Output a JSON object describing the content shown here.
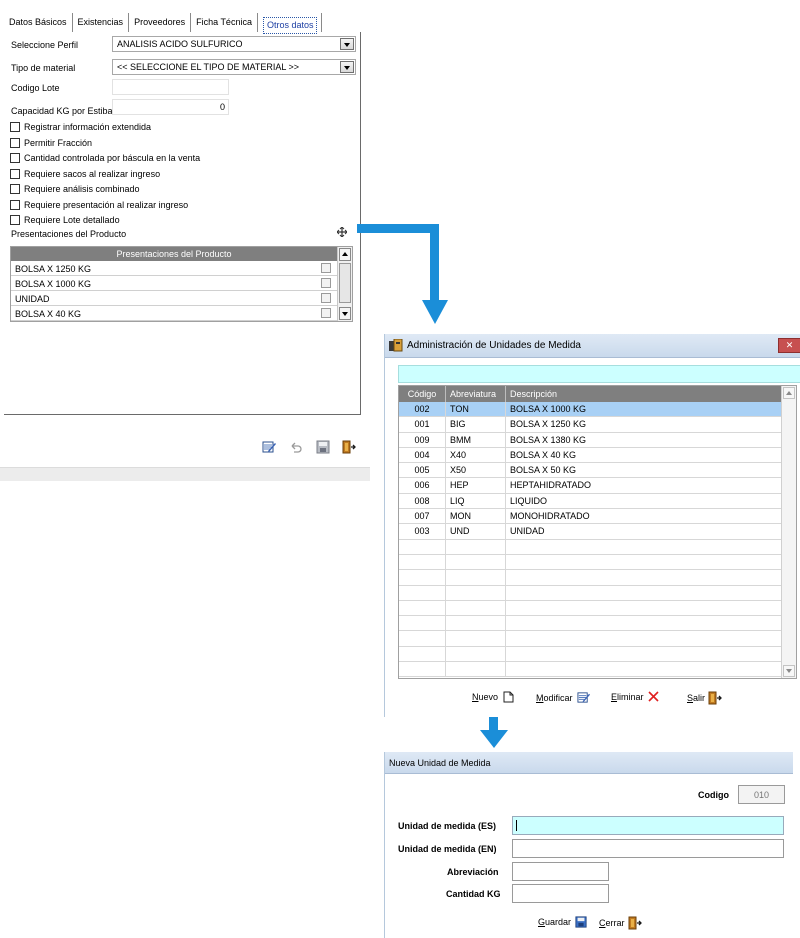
{
  "product_form": {
    "tabs": [
      "Datos Básicos",
      "Existencias",
      "Proveedores",
      "Ficha Técnica",
      "Otros datos"
    ],
    "active_tab": "Otros datos",
    "fields": {
      "perfil_label": "Seleccione Perfil",
      "perfil_value": "ANALISIS ACIDO SULFURICO",
      "tipo_label": "Tipo de material",
      "tipo_value": "<< SELECCIONE EL TIPO DE MATERIAL >>",
      "lote_label": "Codigo Lote",
      "lote_value": "",
      "capacidad_label": "Capacidad KG por Estiba",
      "capacidad_value": "0"
    },
    "checkboxes": [
      "Registrar información extendida",
      "Permitir Fracción",
      "Cantidad controlada por báscula en la venta",
      "Requiere sacos al realizar ingreso",
      "Requiere análisis combinado",
      "Requiere presentación al realizar ingreso",
      "Requiere Lote detallado"
    ],
    "presentaciones_label": "Presentaciones del Producto",
    "presentaciones_header": "Presentaciones del Producto",
    "presentaciones_rows": [
      "BOLSA X 1250 KG",
      "BOLSA X 1000 KG",
      "UNIDAD",
      "BOLSA X 40 KG"
    ]
  },
  "units_window": {
    "title": "Administración de Unidades de Medida",
    "columns": [
      "Código",
      "Abreviatura",
      "Descripción"
    ],
    "rows": [
      {
        "codigo": "002",
        "abrev": "TON",
        "desc": "BOLSA X 1000 KG",
        "selected": true
      },
      {
        "codigo": "001",
        "abrev": "BIG",
        "desc": "BOLSA X 1250 KG"
      },
      {
        "codigo": "009",
        "abrev": "BMM",
        "desc": "BOLSA X 1380 KG"
      },
      {
        "codigo": "004",
        "abrev": "X40",
        "desc": "BOLSA X 40 KG"
      },
      {
        "codigo": "005",
        "abrev": "X50",
        "desc": "BOLSA X 50 KG"
      },
      {
        "codigo": "006",
        "abrev": "HEP",
        "desc": "HEPTAHIDRATADO"
      },
      {
        "codigo": "008",
        "abrev": "LIQ",
        "desc": "LIQUIDO"
      },
      {
        "codigo": "007",
        "abrev": "MON",
        "desc": "MONOHIDRATADO"
      },
      {
        "codigo": "003",
        "abrev": "UND",
        "desc": "UNIDAD"
      }
    ],
    "empty_rows": 9,
    "buttons": {
      "nuevo": "Nuevo",
      "modificar": "Modificar",
      "eliminar": "Eliminar",
      "salir": "Salir"
    }
  },
  "new_unit_window": {
    "title": "Nueva Unidad de Medida",
    "codigo_label": "Codigo",
    "codigo_value": "010",
    "unidad_es_label": "Unidad de medida (ES)",
    "unidad_en_label": "Unidad de medida (EN)",
    "abreviacion_label": "Abreviación",
    "cantidad_label": "Cantidad KG",
    "guardar": "Guardar",
    "cerrar": "Cerrar"
  },
  "colors": {
    "arrow": "#1b8ed8",
    "selected_row": "#a8d0f5",
    "required_field": "#ccffff",
    "grid_header": "#7f7f7f"
  }
}
